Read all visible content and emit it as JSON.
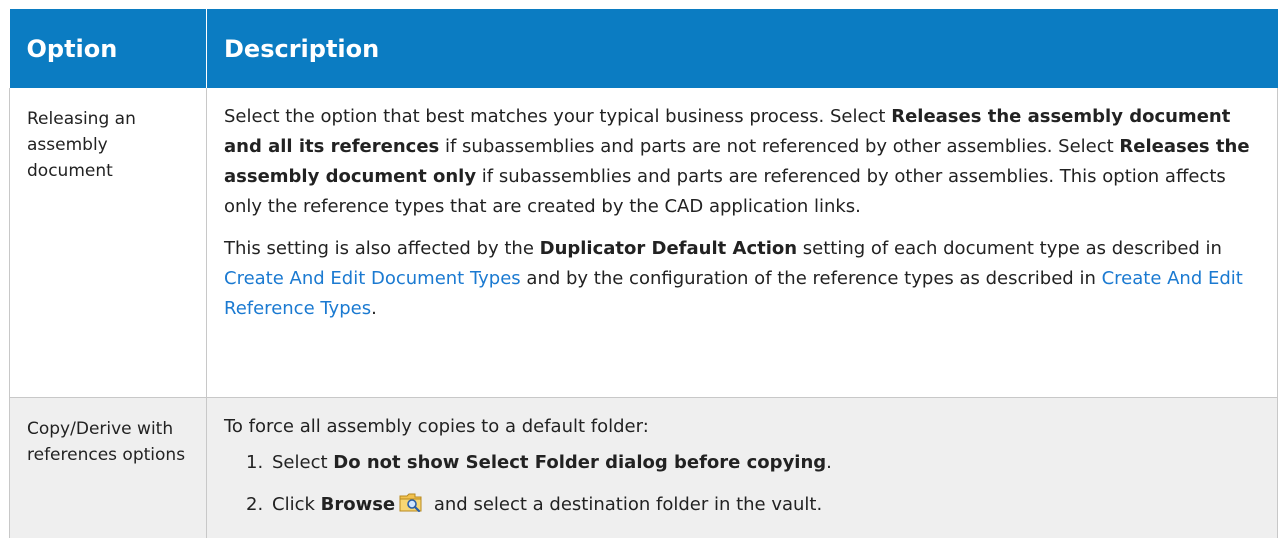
{
  "table": {
    "headers": {
      "option": "Option",
      "description": "Description"
    },
    "rows": [
      {
        "option": "Releasing an assembly document",
        "p1": {
          "t1": "Select the option that best matches your typical business process. Select ",
          "b1": "Releases the assembly document and all its references",
          "t2": " if subassemblies and parts are not referenced by other assemblies. Select ",
          "b2": "Releases the assembly document only",
          "t3": " if subassemblies and parts are referenced by other assemblies. This option affects only the reference types that are created by the CAD application links."
        },
        "p2": {
          "t1": "This setting is also affected by the ",
          "b1": "Duplicator Default Action",
          "t2": " setting of each document type as described in ",
          "link1": "Create And Edit Document Types",
          "t3": " and by the configuration of the reference types as described in ",
          "link2": "Create And Edit Reference Types",
          "t4": "."
        }
      },
      {
        "option": "Copy/Derive with references options",
        "intro": "To force all assembly copies to a default folder:",
        "steps": [
          {
            "num": "1.",
            "t1": "Select ",
            "b1": "Do not show Select Folder dialog before copying",
            "t2": "."
          },
          {
            "num": "2.",
            "t1": "Click ",
            "b1": "Browse",
            "icon": "browse-folder-icon",
            "t2": " and select a destination folder in the vault."
          }
        ]
      }
    ]
  },
  "colors": {
    "header_bg": "#0b7cc2",
    "header_text": "#ffffff",
    "link": "#1b7ad1",
    "row_alt_bg": "#efefef"
  }
}
